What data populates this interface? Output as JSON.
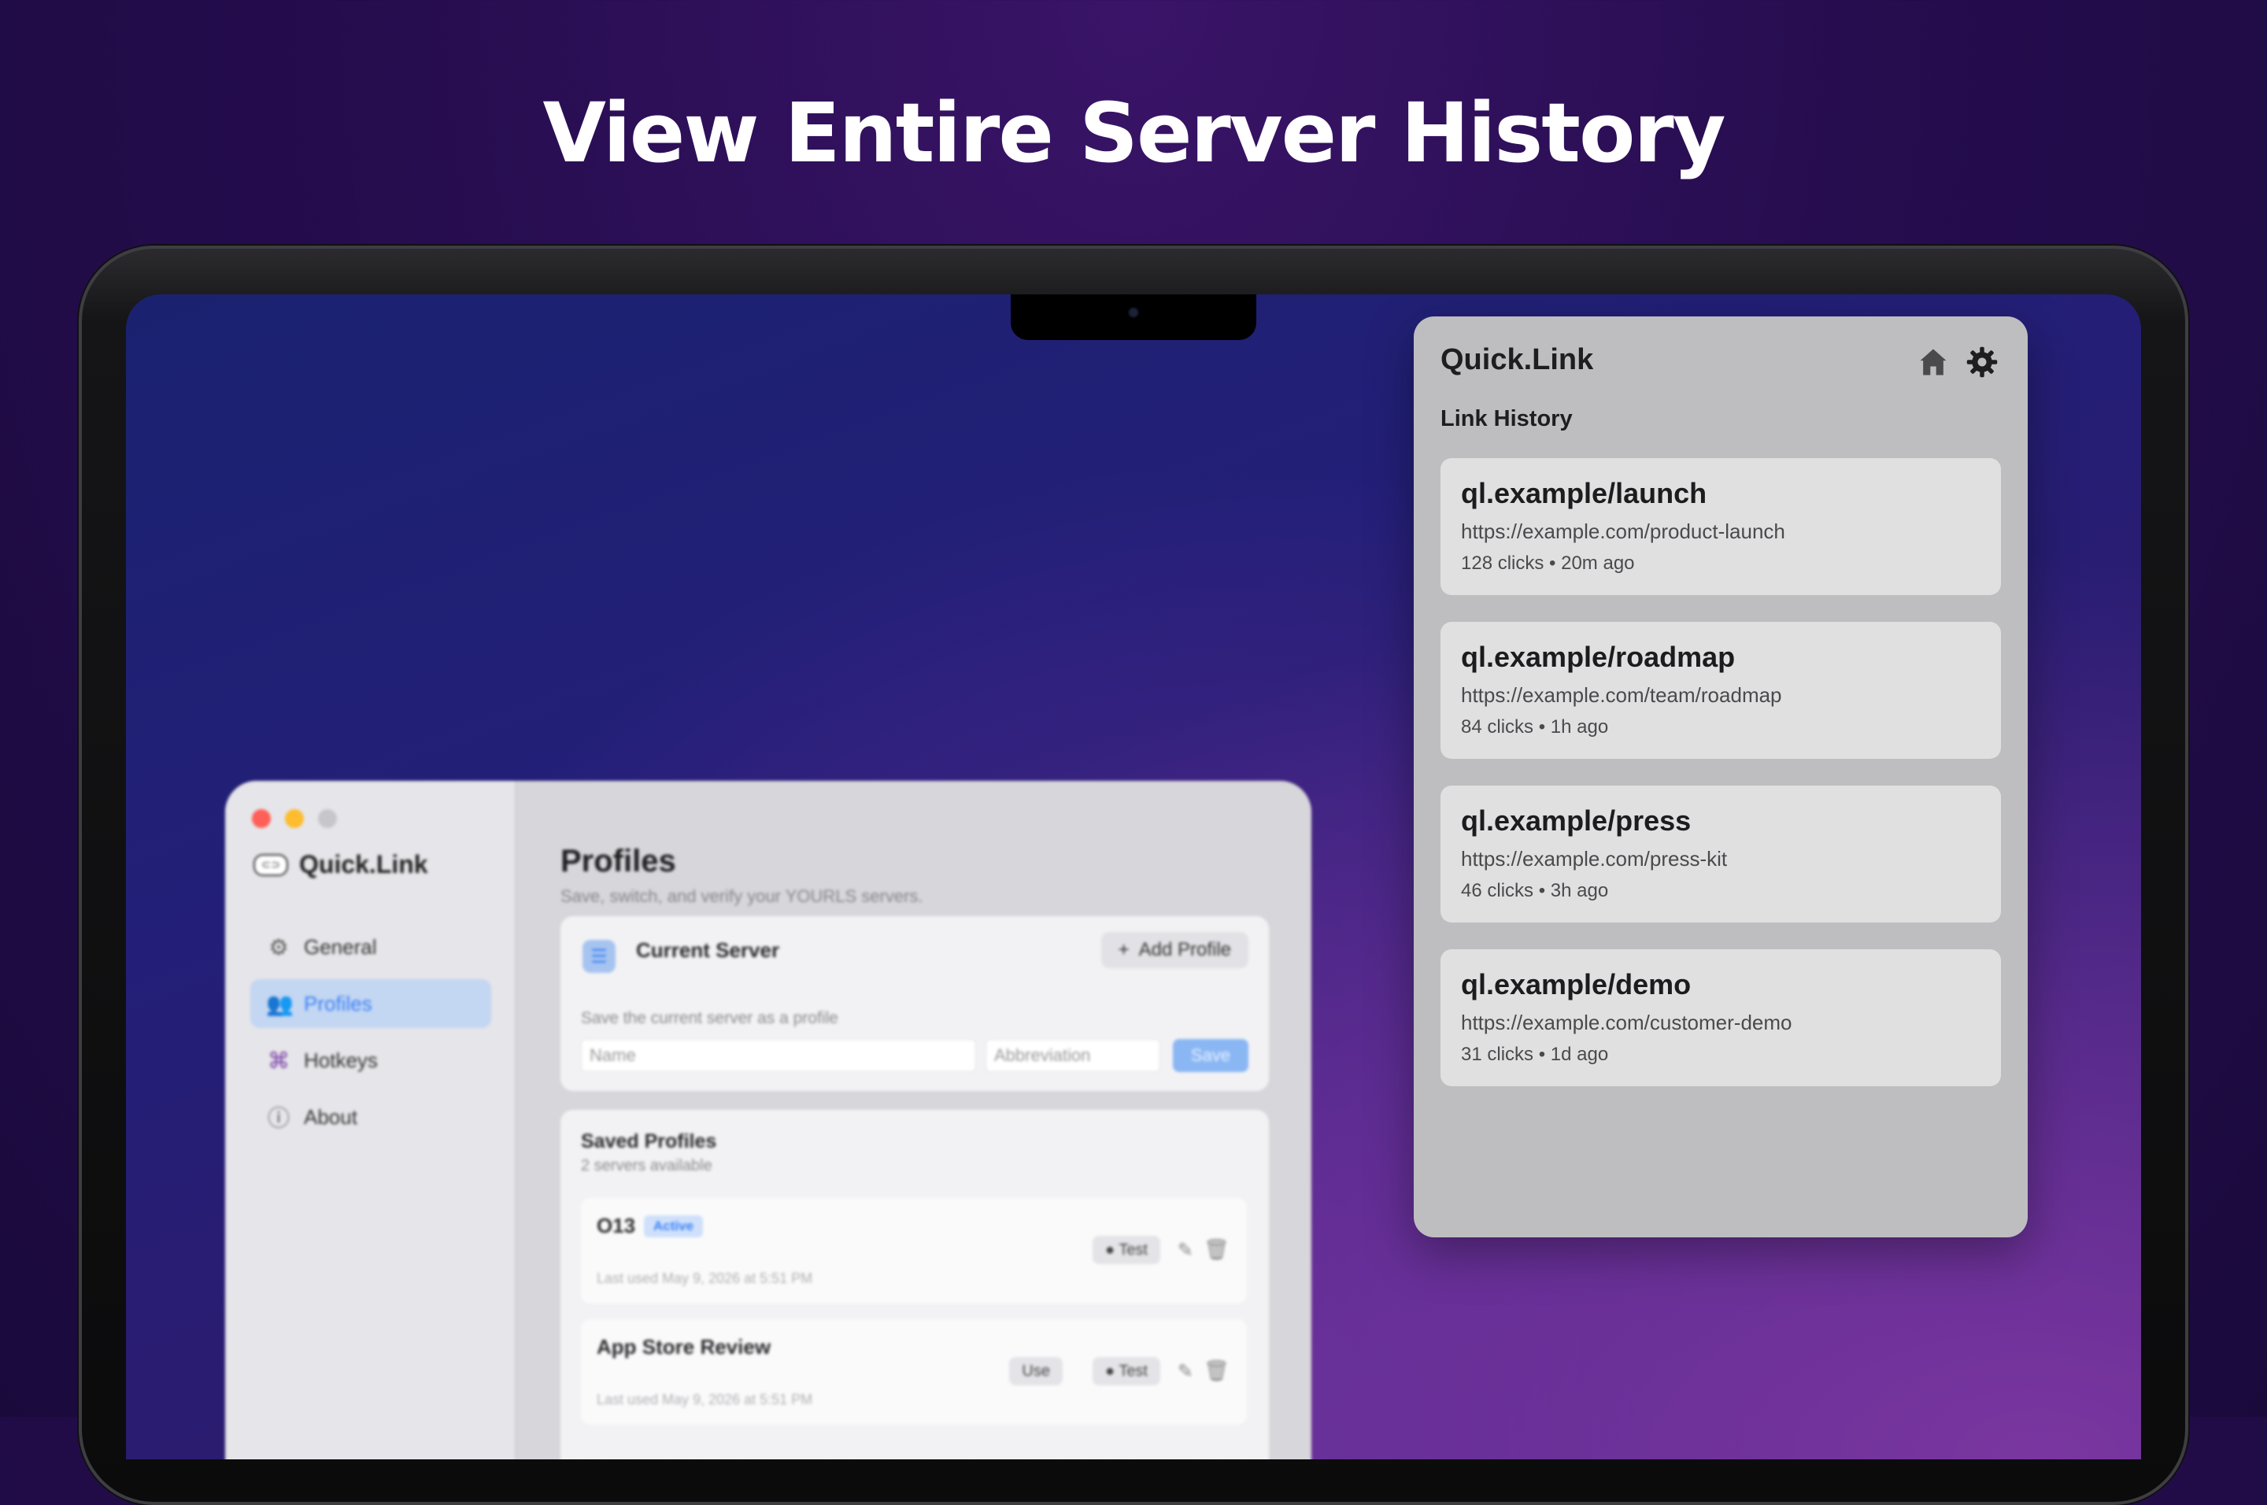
{
  "headline": "View Entire Server History",
  "settings_window": {
    "brand": "Quick.Link",
    "brand_icon": "link-icon",
    "nav": [
      {
        "label": "General",
        "icon": "gear-icon"
      },
      {
        "label": "Profiles",
        "icon": "people-icon",
        "active": true
      },
      {
        "label": "Hotkeys",
        "icon": "command-icon"
      },
      {
        "label": "About",
        "icon": "info-icon"
      }
    ],
    "title": "Profiles",
    "subtitle": "Save, switch, and verify your YOURLS servers.",
    "current_server": {
      "title": "Current Server",
      "add_button": "Add Profile",
      "hint": "Save the current server as a profile",
      "name_placeholder": "Name",
      "abbr_placeholder": "Abbreviation",
      "save_button": "Save"
    },
    "saved_profiles": {
      "title": "Saved Profiles",
      "count": "2 servers available",
      "profiles": [
        {
          "name": "O13",
          "badge": "Active",
          "meta": "Last used May 9, 2026 at 5:51 PM",
          "test_label": "Test"
        },
        {
          "name": "App Store Review",
          "meta": "Last used May 9, 2026 at 5:51 PM",
          "use_label": "Use",
          "test_label": "Test"
        }
      ]
    }
  },
  "popover": {
    "title": "Quick.Link",
    "section": "Link History",
    "links": [
      {
        "short": "ql.example/launch",
        "long": "https://example.com/product-launch",
        "stats": "128 clicks • 20m ago"
      },
      {
        "short": "ql.example/roadmap",
        "long": "https://example.com/team/roadmap",
        "stats": "84 clicks • 1h ago"
      },
      {
        "short": "ql.example/press",
        "long": "https://example.com/press-kit",
        "stats": "46 clicks • 3h ago"
      },
      {
        "short": "ql.example/demo",
        "long": "https://example.com/customer-demo",
        "stats": "31 clicks • 1d ago"
      }
    ]
  },
  "colors": {
    "accent": "#3b82f6",
    "background_top": "#3a1468",
    "popover_bg": "#bebec0"
  }
}
